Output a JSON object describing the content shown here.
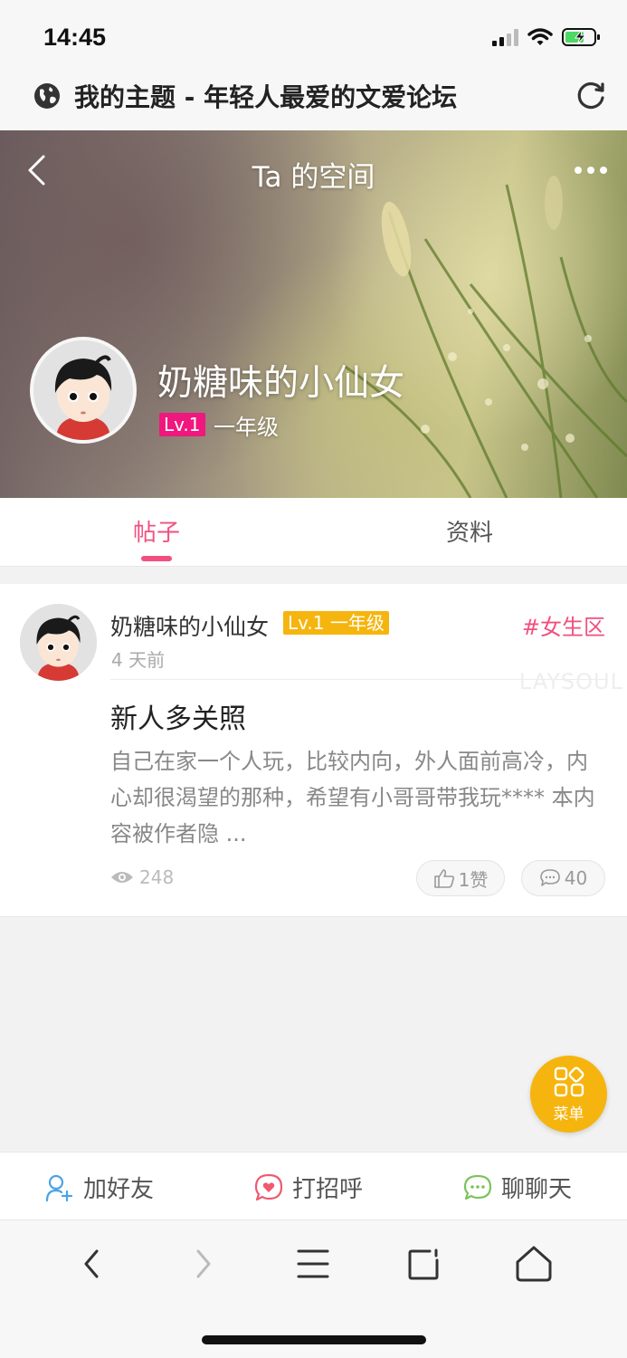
{
  "status_bar": {
    "time": "14:45"
  },
  "browser": {
    "page_title": "我的主题 - 年轻人最爱的文爱论坛"
  },
  "hero": {
    "title": "Ta 的空间",
    "username": "奶糖味的小仙女",
    "level": "Lv.1",
    "grade": "一年级"
  },
  "tabs": [
    {
      "label": "帖子",
      "active": true
    },
    {
      "label": "资料",
      "active": false
    }
  ],
  "post": {
    "author": "奶糖味的小仙女",
    "badge": "Lv.1 一年级",
    "tag": "#女生区",
    "time": "4 天前",
    "watermark": "LAYSOUL",
    "title": "新人多关照",
    "body": "自己在家一个人玩，比较内向，外人面前高冷，内心却很渴望的那种，希望有小哥哥带我玩**** 本内容被作者隐 ...",
    "views": "248",
    "likes": "1赞",
    "comments": "40"
  },
  "fab": {
    "label": "菜单"
  },
  "actions": {
    "add_friend": "加好友",
    "greet": "打招呼",
    "chat": "聊聊天"
  },
  "colors": {
    "accent_pink": "#f24f7f",
    "level_magenta": "#f0177e",
    "badge_yellow": "#f5b50e",
    "fab_yellow": "#f6b40e"
  }
}
